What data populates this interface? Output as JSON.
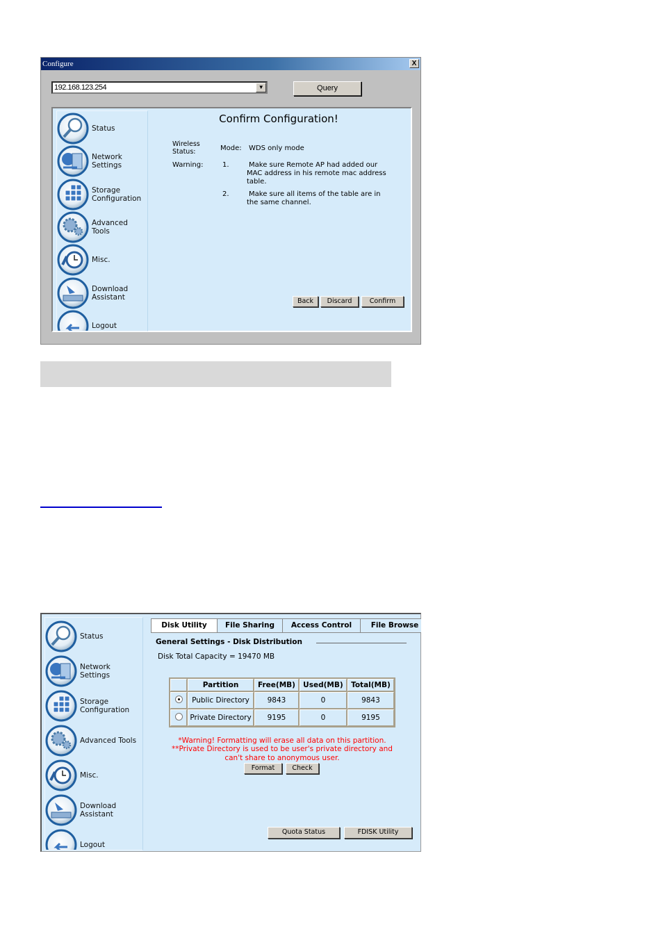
{
  "window1": {
    "title": "Configure",
    "close_label": "X",
    "ip_value": "192.168.123.254",
    "query_label": "Query",
    "heading": "Confirm Configuration!",
    "wireless_label": "Wireless Status:",
    "mode_label": "Mode:",
    "mode_value": "WDS only mode",
    "warning_label": "Warning:",
    "warnings": [
      {
        "num": "1.",
        "text": "Make sure Remote AP had added our MAC address in his remote mac address table."
      },
      {
        "num": "2.",
        "text": "Make sure all items of the table are in the same channel."
      }
    ],
    "buttons": {
      "back": "Back",
      "discard": "Discard",
      "confirm": "Confirm"
    }
  },
  "sidebar": {
    "items": [
      {
        "label": "Status",
        "icon": "magnifier-icon"
      },
      {
        "label": "Network Settings",
        "icon": "network-icon"
      },
      {
        "label": "Storage Configuration",
        "icon": "storage-icon"
      },
      {
        "label": "Advanced Tools",
        "icon": "gears-icon"
      },
      {
        "label": "Misc.",
        "icon": "clock-icon"
      },
      {
        "label": "Download Assistant",
        "icon": "download-icon"
      },
      {
        "label": "Logout",
        "icon": "logout-icon"
      }
    ]
  },
  "window2": {
    "tabs": [
      "Disk Utility",
      "File Sharing",
      "Access Control",
      "File Browse"
    ],
    "section_title": "General Settings - Disk Distribution",
    "capacity": "Disk Total Capacity = 19470 MB",
    "table": {
      "headers": [
        "",
        "Partition",
        "Free(MB)",
        "Used(MB)",
        "Total(MB)"
      ],
      "rows": [
        {
          "selected": true,
          "partition": "Public Directory",
          "free": "9843",
          "used": "0",
          "total": "9843"
        },
        {
          "selected": false,
          "partition": "Private Directory",
          "free": "9195",
          "used": "0",
          "total": "9195"
        }
      ]
    },
    "warning1": "*Warning! Formatting will erase all data on this partition.",
    "warning2": "**Private Directory is used to be user's private directory and can't share to anonymous user.",
    "format_label": "Format",
    "check_label": "Check",
    "quota_label": "Quota Status",
    "fdisk_label": "FDISK Utility"
  },
  "colors": {
    "panel": "#d6ebfa",
    "titlebar": "#0a246a",
    "warning": "#ff0000",
    "link": "#0000cc"
  }
}
